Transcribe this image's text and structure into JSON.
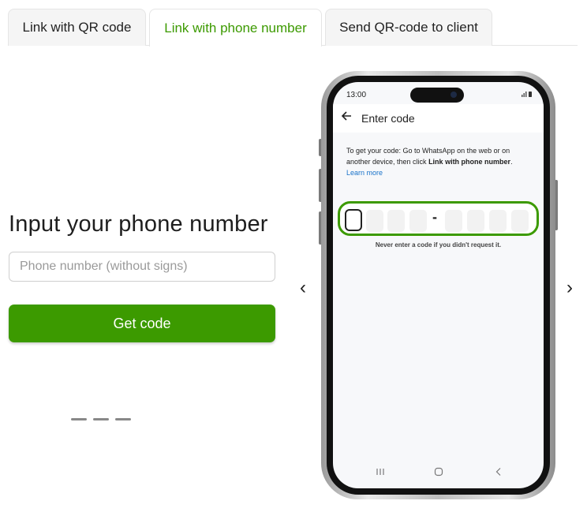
{
  "tabs": [
    {
      "label": "Link with QR code",
      "active": false
    },
    {
      "label": "Link with phone number",
      "active": true
    },
    {
      "label": "Send QR-code to client",
      "active": false
    }
  ],
  "form": {
    "title": "Input your phone number",
    "phone_placeholder": "Phone number (without signs)",
    "phone_value": "",
    "submit_label": "Get code"
  },
  "carousel": {
    "prev_icon": "chevron-left-icon",
    "prev_glyph": "‹",
    "next_icon": "chevron-right-icon",
    "next_glyph": "›"
  },
  "phone_screen": {
    "status_time": "13:00",
    "appbar_title": "Enter code",
    "instructions_prefix": "To get your code: Go to WhatsApp on the web or on another device, then click ",
    "instructions_bold": "Link with phone number",
    "instructions_suffix": ".",
    "learn_more": "Learn more",
    "code_separator": "-",
    "warning": "Never enter a code if you didn't request it."
  },
  "colors": {
    "accent": "#3c9a00",
    "link": "#1a73c9"
  }
}
